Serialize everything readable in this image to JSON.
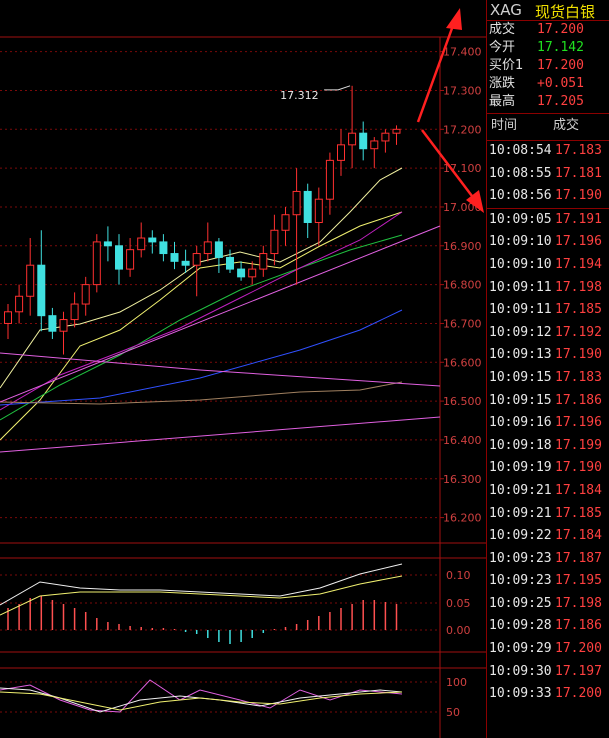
{
  "quote": {
    "symbol": "XAG",
    "name": "现货白银",
    "rows": [
      {
        "label": "成交",
        "value": "17.200",
        "color": "#ff4040"
      },
      {
        "label": "今开",
        "value": "17.142",
        "color": "#20e020"
      },
      {
        "label": "买价1",
        "value": "17.200",
        "color": "#ff4040"
      },
      {
        "label": "涨跌",
        "value": "+0.051",
        "color": "#ff4040"
      },
      {
        "label": "最高",
        "value": "17.205",
        "color": "#ff4040"
      }
    ]
  },
  "trades_header": {
    "time": "时间",
    "price": "成交"
  },
  "trades": [
    {
      "time": "10:08:54",
      "price": "17.183"
    },
    {
      "time": "10:08:55",
      "price": "17.181"
    },
    {
      "time": "10:08:56",
      "price": "17.190"
    },
    {
      "time": "10:09:05",
      "price": "17.191"
    },
    {
      "time": "10:09:10",
      "price": "17.196"
    },
    {
      "time": "10:09:10",
      "price": "17.194"
    },
    {
      "time": "10:09:11",
      "price": "17.198"
    },
    {
      "time": "10:09:11",
      "price": "17.185"
    },
    {
      "time": "10:09:12",
      "price": "17.192"
    },
    {
      "time": "10:09:13",
      "price": "17.190"
    },
    {
      "time": "10:09:15",
      "price": "17.183"
    },
    {
      "time": "10:09:15",
      "price": "17.186"
    },
    {
      "time": "10:09:16",
      "price": "17.196"
    },
    {
      "time": "10:09:18",
      "price": "17.199"
    },
    {
      "time": "10:09:19",
      "price": "17.190"
    },
    {
      "time": "10:09:21",
      "price": "17.184"
    },
    {
      "time": "10:09:21",
      "price": "17.185"
    },
    {
      "time": "10:09:22",
      "price": "17.184"
    },
    {
      "time": "10:09:23",
      "price": "17.187"
    },
    {
      "time": "10:09:23",
      "price": "17.195"
    },
    {
      "time": "10:09:25",
      "price": "17.198"
    },
    {
      "time": "10:09:28",
      "price": "17.186"
    },
    {
      "time": "10:09:29",
      "price": "17.200"
    },
    {
      "time": "10:09:30",
      "price": "17.197"
    },
    {
      "time": "10:09:33",
      "price": "17.200"
    }
  ],
  "chart_data": [
    {
      "type": "candlestick",
      "y_ticks": [
        "17.400",
        "17.300",
        "17.200",
        "17.100",
        "17.000",
        "16.900",
        "16.800",
        "16.700",
        "16.600",
        "16.500",
        "16.400",
        "16.300",
        "16.200"
      ],
      "ylim": [
        16.15,
        17.43
      ],
      "annotation": "17.312",
      "candles": [
        {
          "o": 16.7,
          "h": 16.75,
          "l": 16.66,
          "c": 16.73
        },
        {
          "o": 16.73,
          "h": 16.8,
          "l": 16.7,
          "c": 16.77
        },
        {
          "o": 16.77,
          "h": 16.92,
          "l": 16.72,
          "c": 16.85
        },
        {
          "o": 16.85,
          "h": 16.94,
          "l": 16.68,
          "c": 16.72
        },
        {
          "o": 16.72,
          "h": 16.74,
          "l": 16.66,
          "c": 16.68
        },
        {
          "o": 16.68,
          "h": 16.73,
          "l": 16.62,
          "c": 16.71
        },
        {
          "o": 16.71,
          "h": 16.78,
          "l": 16.69,
          "c": 16.75
        },
        {
          "o": 16.75,
          "h": 16.82,
          "l": 16.72,
          "c": 16.8
        },
        {
          "o": 16.8,
          "h": 16.93,
          "l": 16.78,
          "c": 16.91
        },
        {
          "o": 16.91,
          "h": 16.95,
          "l": 16.86,
          "c": 16.9
        },
        {
          "o": 16.9,
          "h": 16.93,
          "l": 16.8,
          "c": 16.84
        },
        {
          "o": 16.84,
          "h": 16.92,
          "l": 16.82,
          "c": 16.89
        },
        {
          "o": 16.89,
          "h": 16.96,
          "l": 16.87,
          "c": 16.92
        },
        {
          "o": 16.92,
          "h": 16.94,
          "l": 16.88,
          "c": 16.91
        },
        {
          "o": 16.91,
          "h": 16.93,
          "l": 16.86,
          "c": 16.88
        },
        {
          "o": 16.88,
          "h": 16.91,
          "l": 16.84,
          "c": 16.86
        },
        {
          "o": 16.86,
          "h": 16.89,
          "l": 16.83,
          "c": 16.85
        },
        {
          "o": 16.85,
          "h": 16.9,
          "l": 16.77,
          "c": 16.88
        },
        {
          "o": 16.88,
          "h": 16.96,
          "l": 16.86,
          "c": 16.91
        },
        {
          "o": 16.91,
          "h": 16.92,
          "l": 16.83,
          "c": 16.87
        },
        {
          "o": 16.87,
          "h": 16.89,
          "l": 16.83,
          "c": 16.84
        },
        {
          "o": 16.84,
          "h": 16.86,
          "l": 16.81,
          "c": 16.82
        },
        {
          "o": 16.82,
          "h": 16.86,
          "l": 16.8,
          "c": 16.84
        },
        {
          "o": 16.84,
          "h": 16.9,
          "l": 16.82,
          "c": 16.88
        },
        {
          "o": 16.88,
          "h": 16.98,
          "l": 16.85,
          "c": 16.94
        },
        {
          "o": 16.94,
          "h": 17.0,
          "l": 16.9,
          "c": 16.98
        },
        {
          "o": 16.98,
          "h": 17.1,
          "l": 16.8,
          "c": 17.04
        },
        {
          "o": 17.04,
          "h": 17.06,
          "l": 16.92,
          "c": 16.96
        },
        {
          "o": 16.96,
          "h": 17.05,
          "l": 16.9,
          "c": 17.02
        },
        {
          "o": 17.02,
          "h": 17.14,
          "l": 16.98,
          "c": 17.12
        },
        {
          "o": 17.12,
          "h": 17.2,
          "l": 17.08,
          "c": 17.16
        },
        {
          "o": 17.16,
          "h": 17.312,
          "l": 17.1,
          "c": 17.19
        },
        {
          "o": 17.19,
          "h": 17.22,
          "l": 17.12,
          "c": 17.15
        },
        {
          "o": 17.15,
          "h": 17.18,
          "l": 17.1,
          "c": 17.17
        },
        {
          "o": 17.17,
          "h": 17.2,
          "l": 17.14,
          "c": 17.19
        },
        {
          "o": 17.19,
          "h": 17.21,
          "l": 17.16,
          "c": 17.2
        }
      ]
    },
    {
      "type": "line",
      "y_ticks": [
        "0.10",
        "0.05",
        "0.00"
      ]
    },
    {
      "type": "line",
      "y_ticks": [
        "100",
        "50"
      ]
    }
  ]
}
